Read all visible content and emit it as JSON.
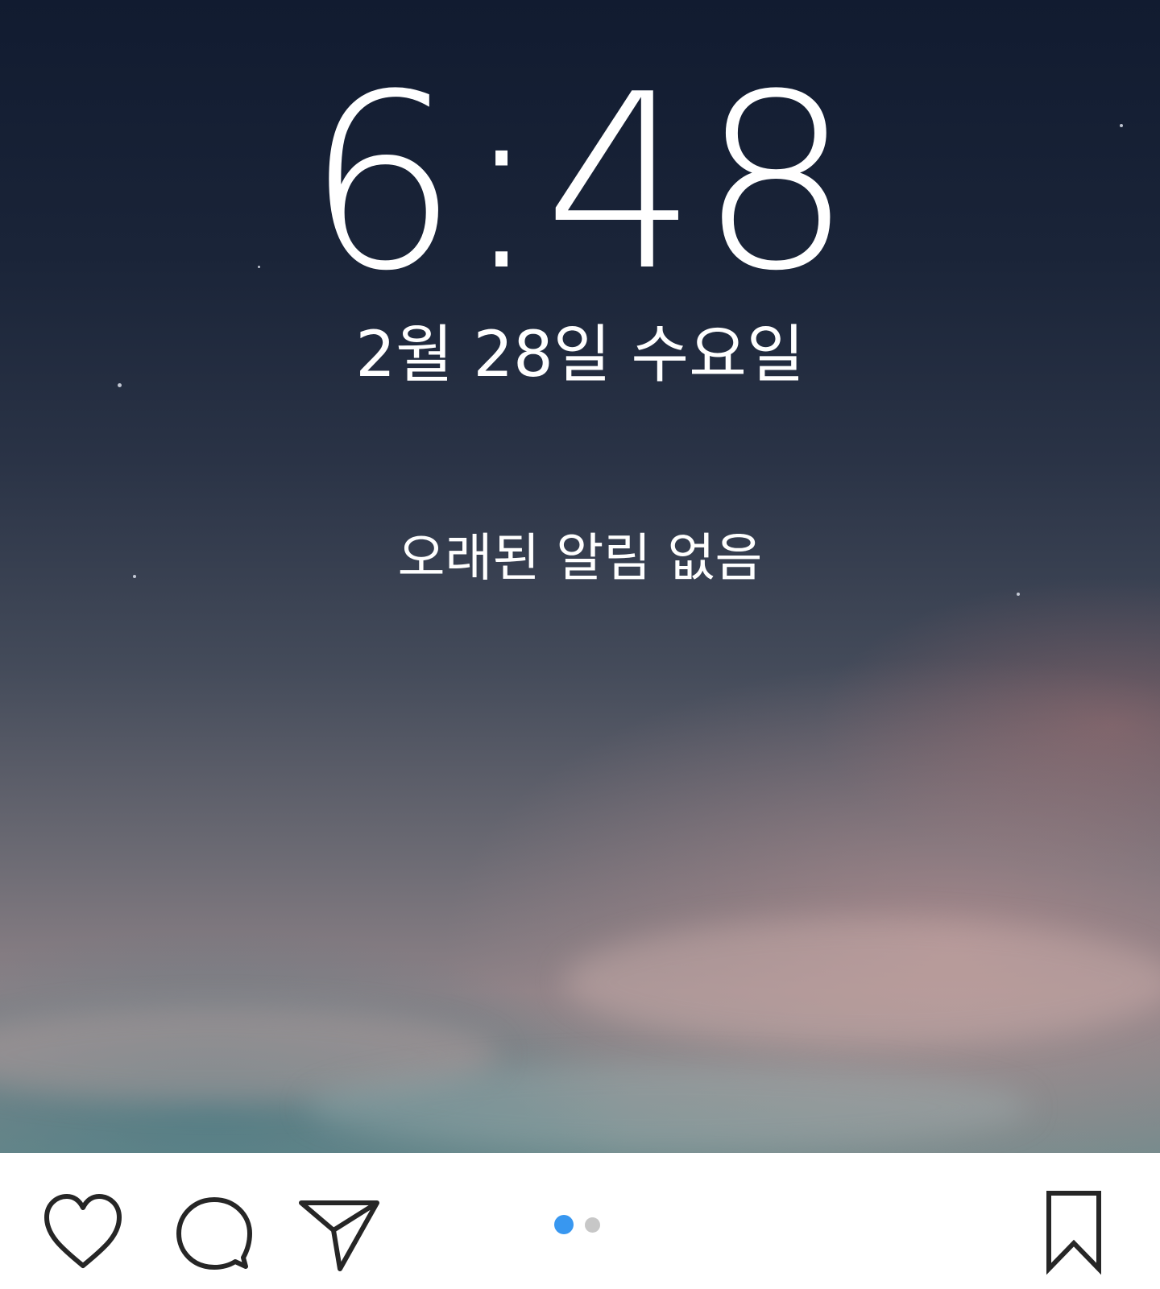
{
  "lockscreen": {
    "time": "6:48",
    "date": "2월 28일 수요일",
    "notification_text": "오래된 알림 없음"
  },
  "actions": {
    "like_icon": "heart-icon",
    "comment_icon": "speech-bubble-icon",
    "share_icon": "paper-plane-icon",
    "save_icon": "bookmark-icon"
  },
  "carousel": {
    "total": 2,
    "active_index": 0,
    "active_color": "#3897f0",
    "inactive_color": "#c7c7c7"
  },
  "colors": {
    "icon_stroke": "#262626",
    "bar_background": "#ffffff"
  }
}
